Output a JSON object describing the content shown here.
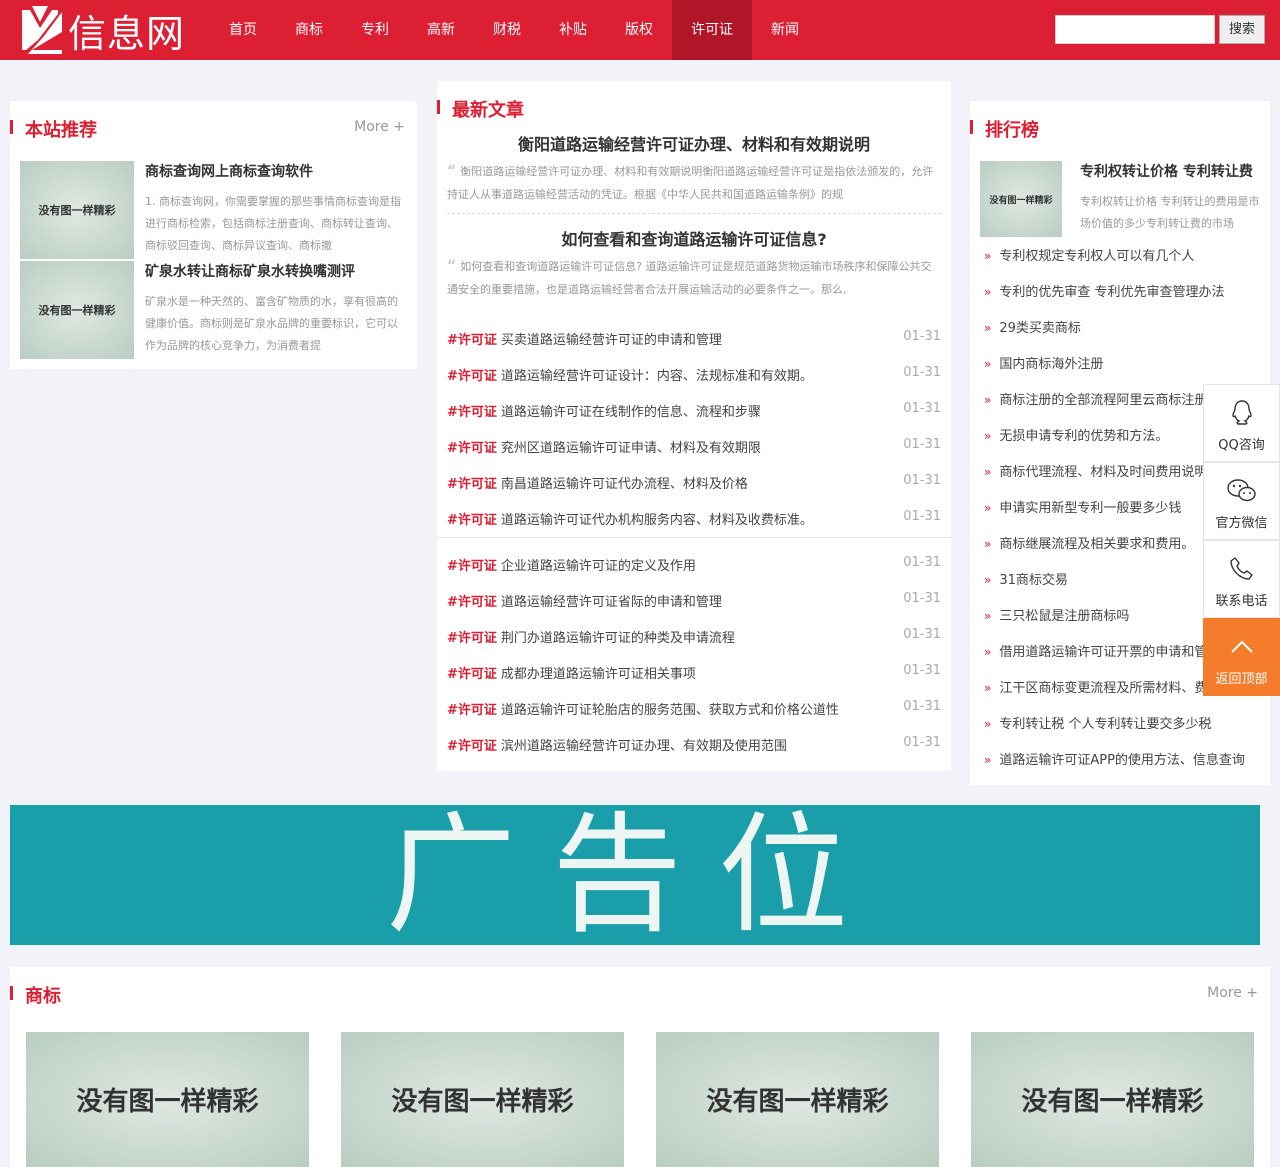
{
  "header": {
    "logo_text": "信息网",
    "nav": [
      {
        "label": "首页",
        "active": false
      },
      {
        "label": "商标",
        "active": false
      },
      {
        "label": "专利",
        "active": false
      },
      {
        "label": "高新",
        "active": false
      },
      {
        "label": "财税",
        "active": false
      },
      {
        "label": "补贴",
        "active": false
      },
      {
        "label": "版权",
        "active": false
      },
      {
        "label": "许可证",
        "active": true
      },
      {
        "label": "新闻",
        "active": false
      }
    ],
    "search_value": "",
    "search_button": "搜索"
  },
  "recommend": {
    "title": "本站推荐",
    "more": "More +",
    "items": [
      {
        "thumb": "没有图一样精彩",
        "title": "商标查询网上商标查询软件",
        "desc": "1. 商标查询网，你需要掌握的那些事情商标查询是指进行商标检索，包括商标注册查询、商标转让查询、商标驳回查询、商标异议查询、商标撤"
      },
      {
        "thumb": "没有图一样精彩",
        "title": "矿泉水转让商标矿泉水转换嘴测评",
        "desc": "矿泉水是一种天然的、富含矿物质的水，享有很高的健康价值。商标则是矿泉水品牌的重要标识，它可以作为品牌的核心竞争力，为消费者提"
      }
    ]
  },
  "latest": {
    "title": "最新文章",
    "featured": [
      {
        "title": "衡阳道路运输经营许可证办理、材料和有效期说明",
        "desc": "衡阳道路运输经营许可证办理、材料和有效期说明衡阳道路运输经营许可证是指依法颁发的，允许持证人从事道路运输经营活动的凭证。根据《中华人民共和国道路运输条例》的规"
      },
      {
        "title": "如何查看和查询道路运输许可证信息?",
        "desc": "如何查看和查询道路运输许可证信息? 道路运输许可证是规范道路货物运输市场秩序和保障公共交通安全的重要措施，也是道路运输经营者合法开展运输活动的必要条件之一。那么,"
      }
    ],
    "tag": "#许可证",
    "list1": [
      {
        "title": "买卖道路运输经营许可证的申请和管理",
        "date": "01-31"
      },
      {
        "title": "道路运输经营许可证设计：内容、法规标准和有效期。",
        "date": "01-31"
      },
      {
        "title": "道路运输许可证在线制作的信息、流程和步骤",
        "date": "01-31"
      },
      {
        "title": "兖州区道路运输许可证申请、材料及有效期限",
        "date": "01-31"
      },
      {
        "title": "南昌道路运输许可证代办流程、材料及价格",
        "date": "01-31"
      },
      {
        "title": "道路运输许可证代办机构服务内容、材料及收费标准。",
        "date": "01-31"
      }
    ],
    "list2": [
      {
        "title": "企业道路运输许可证的定义及作用",
        "date": "01-31"
      },
      {
        "title": "道路运输经营许可证省际的申请和管理",
        "date": "01-31"
      },
      {
        "title": "荆门办道路运输许可证的种类及申请流程",
        "date": "01-31"
      },
      {
        "title": "成都办理道路运输许可证相关事项",
        "date": "01-31"
      },
      {
        "title": "道路运输许可证轮胎店的服务范围、获取方式和价格公道性",
        "date": "01-31"
      },
      {
        "title": "滨州道路运输经营许可证办理、有效期及使用范围",
        "date": "01-31"
      }
    ]
  },
  "ranking": {
    "title": "排行榜",
    "top": {
      "thumb": "没有图一样精彩",
      "title": "专利权转让价格 专利转让费",
      "desc": "专利权转让价格 专利转让的费用是市场价值的多少专利转让费的市场"
    },
    "items": [
      "专利权规定专利权人可以有几个人",
      "专利的优先审查 专利优先审查管理办法",
      "29类买卖商标",
      "国内商标海外注册",
      "商标注册的全部流程阿里云商标注册",
      "无损申请专利的优势和方法。",
      "商标代理流程、材料及时间费用说明",
      "申请实用新型专利一般要多少钱",
      "商标继展流程及相关要求和费用。",
      "31商标交易",
      "三只松鼠是注册商标吗",
      "借用道路运输许可证开票的申请和管理",
      "江干区商标变更流程及所需材料、费用",
      "专利转让税 个人专利转让要交多少税",
      "道路运输许可证APP的使用方法、信息查询"
    ]
  },
  "side_tools": [
    {
      "label": "QQ咨询",
      "icon": "qq-icon"
    },
    {
      "label": "官方微信",
      "icon": "wechat-icon"
    },
    {
      "label": "联系电话",
      "icon": "phone-icon"
    },
    {
      "label": "返回顶部",
      "icon": "chevron-up-icon"
    }
  ],
  "ad": {
    "text": "广告位",
    "color": "#1a9ea9"
  },
  "trademark": {
    "title": "商标",
    "more": "More +",
    "cards": [
      "没有图一样精彩",
      "没有图一样精彩",
      "没有图一样精彩",
      "没有图一样精彩"
    ]
  },
  "colors": {
    "brand": "#dc1f32",
    "accent": "#f47c2a"
  }
}
